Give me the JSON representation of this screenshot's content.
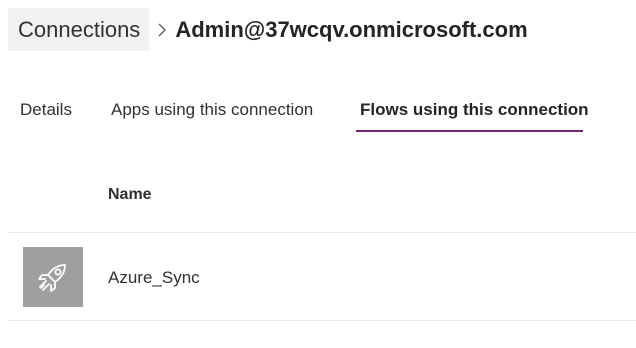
{
  "breadcrumb": {
    "parent_label": "Connections",
    "current_label": "Admin@37wcqv.onmicrosoft.com",
    "separator_icon": "chevron-right-icon"
  },
  "tabs": [
    {
      "label": "Details",
      "active": false
    },
    {
      "label": "Apps using this connection",
      "active": false
    },
    {
      "label": "Flows using this connection",
      "active": true
    }
  ],
  "list": {
    "column_header": "Name",
    "rows": [
      {
        "name": "Azure_Sync",
        "icon": "rocket-icon"
      }
    ]
  },
  "colors": {
    "accent": "#742774",
    "icon_tile": "#a19f9d",
    "breadcrumb_bg": "#f3f2f1",
    "divider": "#edebe9"
  }
}
